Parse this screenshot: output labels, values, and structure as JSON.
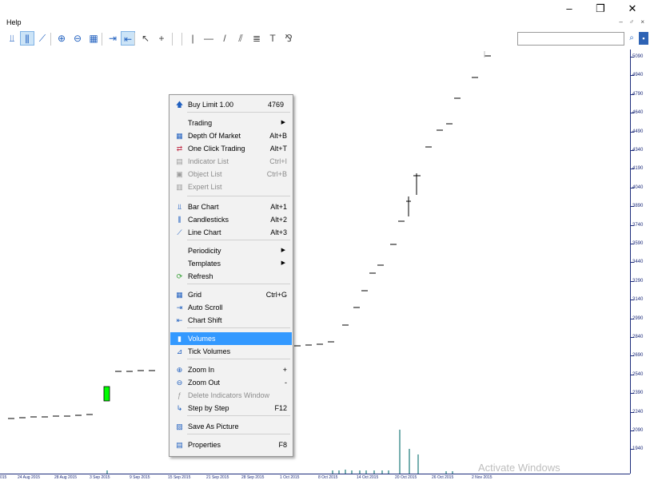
{
  "window": {
    "minimize_glyph": "–",
    "restore_glyph": "❐",
    "close_glyph": "✕"
  },
  "menubar": {
    "help_label": "Help",
    "mdi_controls": "– ♂ ×"
  },
  "toolbar": {
    "items": [
      {
        "name": "bar-chart-icon",
        "glyph": "⫫"
      },
      {
        "name": "candlesticks-icon",
        "glyph": "⫼"
      },
      {
        "name": "line-chart-icon",
        "glyph": "⟋"
      },
      {
        "name": "zoom-in-icon",
        "glyph": "⊕"
      },
      {
        "name": "zoom-out-icon",
        "glyph": "⊖"
      },
      {
        "name": "tile-windows-icon",
        "glyph": "▦"
      },
      {
        "name": "auto-scroll-icon",
        "glyph": "⇥"
      },
      {
        "name": "chart-shift-icon",
        "glyph": "⇤"
      },
      {
        "name": "cursor-icon",
        "glyph": "↖"
      },
      {
        "name": "crosshair-icon",
        "glyph": "+"
      },
      {
        "name": "vertical-line-icon",
        "glyph": "|"
      },
      {
        "name": "horizontal-line-icon",
        "glyph": "—"
      },
      {
        "name": "trendline-icon",
        "glyph": "/"
      },
      {
        "name": "equidistant-channel-icon",
        "glyph": "⫽"
      },
      {
        "name": "fibonacci-icon",
        "glyph": "≣"
      },
      {
        "name": "text-icon",
        "glyph": "T"
      },
      {
        "name": "arrows-icon",
        "glyph": "⅋"
      }
    ],
    "search_icon": "⌕",
    "community_icon": "▪"
  },
  "context_menu": {
    "buy_limit": {
      "label": "Buy Limit 1.00",
      "value": "4769"
    },
    "items": [
      {
        "label": "Trading",
        "shortcut": "",
        "submenu": true
      },
      {
        "label": "Depth Of Market",
        "shortcut": "Alt+B"
      },
      {
        "label": "One Click Trading",
        "shortcut": "Alt+T"
      },
      {
        "label": "Indicator List",
        "shortcut": "Ctrl+I",
        "disabled": true
      },
      {
        "label": "Object List",
        "shortcut": "Ctrl+B",
        "disabled": true
      },
      {
        "label": "Expert List",
        "shortcut": "",
        "disabled": true
      },
      {
        "label": "Bar Chart",
        "shortcut": "Alt+1"
      },
      {
        "label": "Candlesticks",
        "shortcut": "Alt+2"
      },
      {
        "label": "Line Chart",
        "shortcut": "Alt+3"
      },
      {
        "label": "Periodicity",
        "submenu": true
      },
      {
        "label": "Templates",
        "submenu": true
      },
      {
        "label": "Refresh",
        "shortcut": ""
      },
      {
        "label": "Grid",
        "shortcut": "Ctrl+G"
      },
      {
        "label": "Auto Scroll",
        "shortcut": ""
      },
      {
        "label": "Chart Shift",
        "shortcut": ""
      },
      {
        "label": "Volumes",
        "shortcut": ""
      },
      {
        "label": "Tick Volumes",
        "shortcut": ""
      },
      {
        "label": "Zoom In",
        "shortcut": "+"
      },
      {
        "label": "Zoom Out",
        "shortcut": "-"
      },
      {
        "label": "Delete Indicators Window",
        "shortcut": "",
        "disabled": true
      },
      {
        "label": "Step by Step",
        "shortcut": "F12"
      },
      {
        "label": "Save As Picture",
        "shortcut": ""
      },
      {
        "label": "Properties",
        "shortcut": "F8"
      }
    ]
  },
  "price_axis": {
    "labels": [
      "5090",
      "4940",
      "4790",
      "4640",
      "4490",
      "4340",
      "4190",
      "4040",
      "3890",
      "3740",
      "3590",
      "3440",
      "3290",
      "3140",
      "2990",
      "2840",
      "2690",
      "2540",
      "2390",
      "2240",
      "2090",
      "1940"
    ]
  },
  "date_axis": {
    "labels": [
      "015",
      "24 Aug 2015",
      "28 Aug 2015",
      "3 Sep 2015",
      "9 Sep 2015",
      "15 Sep 2015",
      "21 Sep 2015",
      "28 Sep 2015",
      "1 Oct 2015",
      "8 Oct 2015",
      "14 Oct 2015",
      "20 Oct 2015",
      "26 Oct 2015",
      "2 Nov 2015"
    ]
  },
  "watermark": "Activate Windows",
  "colors": {
    "axis": "#1c2b7a",
    "highlight": "#3399ff",
    "bull_candle": "#00ff00",
    "volume": "#1a7a7a"
  }
}
